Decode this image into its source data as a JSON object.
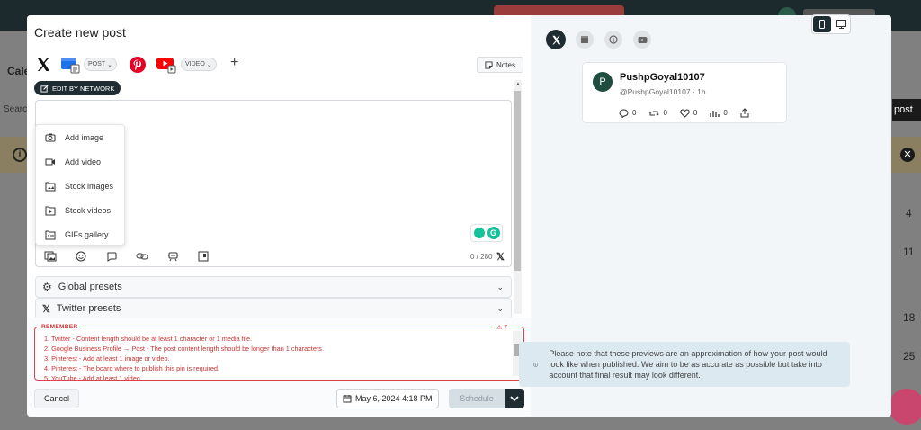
{
  "background": {
    "calendar_label": "Cale",
    "search_label": "Searc",
    "post_button": "post",
    "day_numbers": [
      "4",
      "11",
      "18",
      "25"
    ]
  },
  "modal": {
    "title": "Create new post",
    "networks": {
      "gbp_type": "POST",
      "youtube_type": "VIDEO",
      "notes_label": "Notes",
      "edit_by_network": "EDIT BY NETWORK"
    },
    "media_menu": [
      {
        "label": "Add image",
        "icon": "camera-icon"
      },
      {
        "label": "Add video",
        "icon": "video-icon"
      },
      {
        "label": "Stock images",
        "icon": "stock-images-icon"
      },
      {
        "label": "Stock videos",
        "icon": "stock-videos-icon"
      },
      {
        "label": "GIFs gallery",
        "icon": "gif-gallery-icon"
      }
    ],
    "char_count": "0 / 280",
    "presets": {
      "global": "Global presets",
      "twitter": "Twitter presets"
    },
    "remember": {
      "title": "REMEMBER",
      "count": "7",
      "items": [
        "1. Twitter - Content length should be at least 1 character or 1 media file.",
        "2. Google Business Profile → Post - The post content length should be longer than 1 characters.",
        "3. Pinterest - Add at least 1 image or video.",
        "4. Pinterest - The board where to publish this pin is required.",
        "5. YouTube - Add at least 1 video."
      ]
    },
    "cancel_label": "Cancel",
    "date_value": "May 6, 2024 4:18 PM",
    "schedule_label": "Schedule"
  },
  "preview": {
    "username": "PushpGoyal10107",
    "avatar_letter": "P",
    "handle": "@PushpGoyal10107 · 1h",
    "replies": "0",
    "retweets": "0",
    "likes": "0",
    "views": "0",
    "note": "Please note that these previews are an approximation of how your post would look like when published. We aim to be as accurate as possible but take into account that final result may look different."
  },
  "colors": {
    "accent_dark": "#1f2d33",
    "error": "#d8434d",
    "pinterest": "#e60023",
    "youtube": "#ff0000",
    "gbp": "#1a73e8"
  }
}
